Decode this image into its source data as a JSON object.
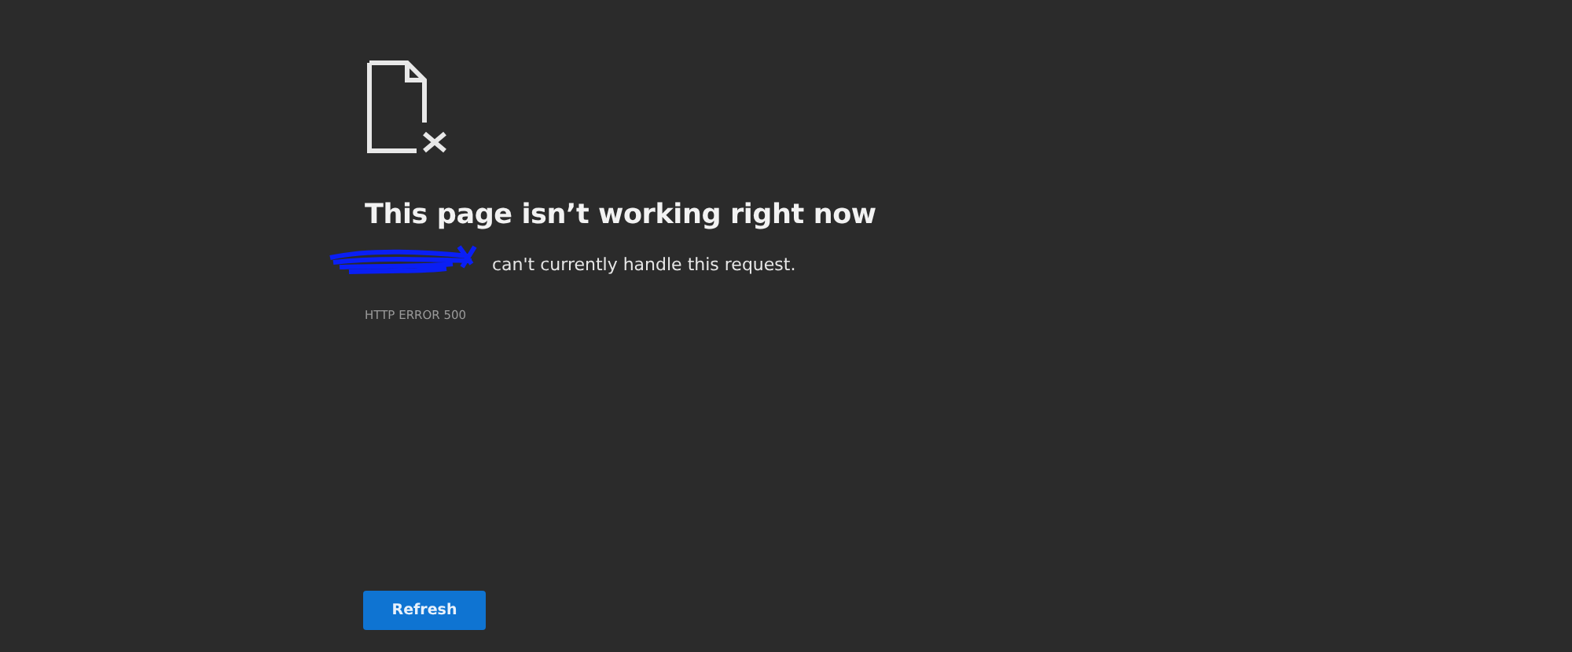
{
  "title": "This page isn’t working right now",
  "message": "can't currently handle this request.",
  "error_code": "HTTP ERROR 500",
  "buttons": [
    "Refresh"
  ]
}
